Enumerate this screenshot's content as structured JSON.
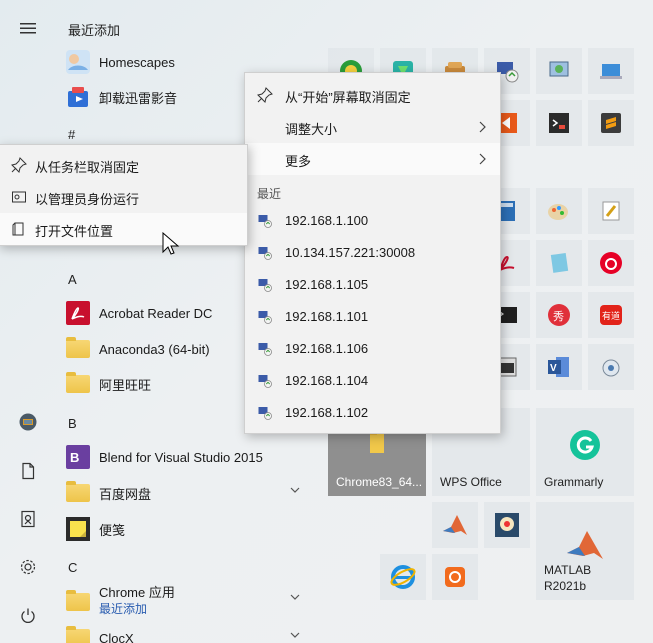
{
  "applist": {
    "recently_added_heading": "最近添加",
    "hash_heading": "#",
    "a_heading": "A",
    "b_heading": "B",
    "c_heading": "C",
    "items": [
      {
        "label": "Homescapes"
      },
      {
        "label": "卸载迅雷影音"
      },
      {
        "label": "Acrobat Reader DC"
      },
      {
        "label": "Anaconda3 (64-bit)"
      },
      {
        "label": "阿里旺旺"
      },
      {
        "label": "Blend for Visual Studio 2015"
      },
      {
        "label": "百度网盘"
      },
      {
        "label": "便笺"
      },
      {
        "label": "Chrome 应用",
        "sub": "最近添加"
      },
      {
        "label": "ClocX"
      }
    ]
  },
  "taskbar_menu": {
    "items": [
      {
        "label": "从任务栏取消固定",
        "icon": "unpin-icon"
      },
      {
        "label": "以管理员身份运行",
        "icon": "shield-icon"
      },
      {
        "label": "打开文件位置",
        "icon": "file-location-icon"
      }
    ]
  },
  "tile_menu": {
    "items": [
      {
        "label": "从“开始”屏幕取消固定",
        "icon": "unpin-icon"
      },
      {
        "label": "调整大小"
      },
      {
        "label": "更多"
      }
    ],
    "recent_heading": "最近",
    "recent": [
      "192.168.1.100",
      "10.134.157.221:30008",
      "192.168.1.105",
      "192.168.1.101",
      "192.168.1.106",
      "192.168.1.104",
      "192.168.1.102"
    ]
  },
  "tiles": {
    "chrome_label": "Chrome83_64...",
    "wps_label": "WPS Office",
    "grammarly_label": "Grammarly",
    "matlab_label_line1": "MATLAB",
    "matlab_label_line2": "R2021b"
  },
  "colors": {
    "accent_blue": "#2a5db0",
    "acrobat_red": "#c8102e",
    "grammarly_green": "#15c39a",
    "wps_orange": "#f26b1d"
  }
}
